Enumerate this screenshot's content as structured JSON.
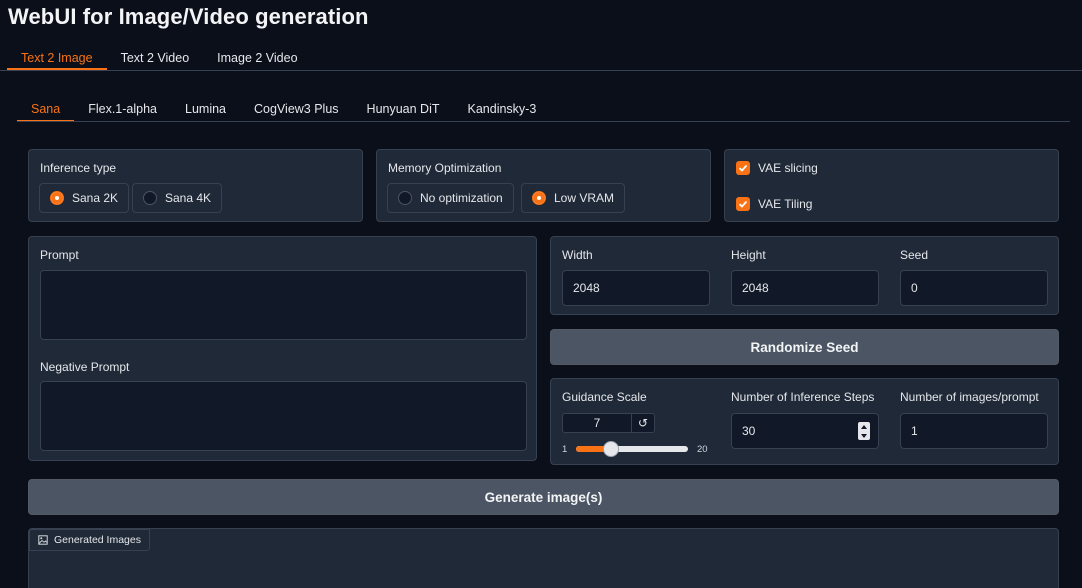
{
  "app": {
    "title": "WebUI for Image/Video generation"
  },
  "top_tabs": [
    "Text 2 Image",
    "Text 2 Video",
    "Image 2 Video"
  ],
  "top_tab_active": "Text 2 Image",
  "model_tabs": [
    "Sana",
    "Flex.1-alpha",
    "Lumina",
    "CogView3 Plus",
    "Hunyuan DiT",
    "Kandinsky-3"
  ],
  "model_tab_active": "Sana",
  "inference_type": {
    "label": "Inference type",
    "options": [
      "Sana 2K",
      "Sana 4K"
    ],
    "selected": "Sana 2K"
  },
  "memory_optimization": {
    "label": "Memory Optimization",
    "options": [
      "No optimization",
      "Low VRAM"
    ],
    "selected": "Low VRAM"
  },
  "vae": {
    "slicing_label": "VAE slicing",
    "slicing_checked": true,
    "tiling_label": "VAE Tiling",
    "tiling_checked": true
  },
  "prompt": {
    "label": "Prompt",
    "value": ""
  },
  "negative_prompt": {
    "label": "Negative Prompt",
    "value": ""
  },
  "width": {
    "label": "Width",
    "value": "2048"
  },
  "height": {
    "label": "Height",
    "value": "2048"
  },
  "seed": {
    "label": "Seed",
    "value": "0"
  },
  "randomize_seed": {
    "label": "Randomize Seed"
  },
  "guidance_scale": {
    "label": "Guidance Scale",
    "value": "7",
    "min": "1",
    "max": "20",
    "reset_icon": "↺"
  },
  "inference_steps": {
    "label": "Number of Inference Steps",
    "value": "30"
  },
  "images_per_prompt": {
    "label": "Number of images/prompt",
    "value": "1"
  },
  "generate": {
    "label": "Generate image(s)"
  },
  "output": {
    "label": "Generated Images",
    "icon": "image-icon"
  },
  "colors": {
    "accent": "#f97316",
    "background": "#0b0f19",
    "panel": "#1f2937",
    "input": "#111827",
    "button": "#4b5563"
  }
}
